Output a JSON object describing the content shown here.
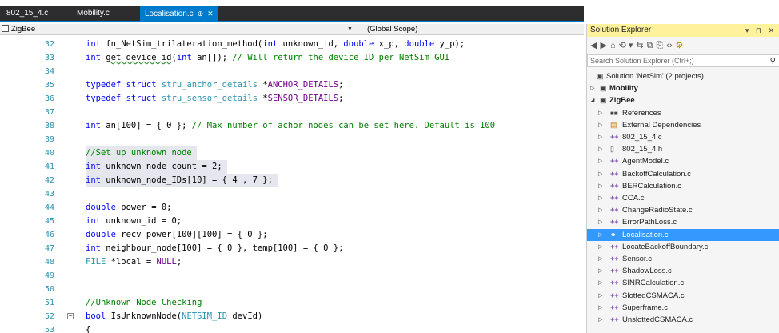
{
  "tabs": [
    {
      "label": "802_15_4.c",
      "active": false
    },
    {
      "label": "Mobility.c",
      "active": false
    },
    {
      "label": "Localisation.c",
      "active": true,
      "pin": "⊕",
      "close": "✕"
    }
  ],
  "navbar": {
    "project": "ZigBee",
    "scope": "(Global Scope)"
  },
  "code_lines": [
    {
      "n": "32",
      "html": "<span class=\"kw\">int</span> fn_NetSim_trilateration_method(<span class=\"kw\">int</span> unknown_id, <span class=\"kw\">double</span> x_p, <span class=\"kw\">double</span> y_p);"
    },
    {
      "n": "33",
      "html": "<span class=\"kw\">int</span> <span class=\"squig\">get_device_id</span>(<span class=\"kw\">int</span> an[]); <span class=\"cm\">// Will return the device ID per NetSim GUI</span>"
    },
    {
      "n": "34",
      "html": ""
    },
    {
      "n": "35",
      "html": "<span class=\"kw\">typedef</span> <span class=\"kw\">struct</span> <span class=\"ty\">stru_anchor_details</span> *<span class=\"pp\">ANCHOR_DETAILS</span>;"
    },
    {
      "n": "36",
      "html": "<span class=\"kw\">typedef</span> <span class=\"kw\">struct</span> <span class=\"ty\">stru_sensor_details</span> *<span class=\"pp\">SENSOR_DETAILS</span>;"
    },
    {
      "n": "37",
      "html": ""
    },
    {
      "n": "38",
      "html": "<span class=\"kw\">int</span> an[100] = { 0 }; <span class=\"cm\">// Max number of achor nodes can be set here. Default is 100</span>"
    },
    {
      "n": "39",
      "html": ""
    },
    {
      "n": "40",
      "html": "<span class=\"cm\">//Set up unknown node</span>",
      "hl": 163
    },
    {
      "n": "41",
      "html": "<span class=\"kw\">int</span> unknown_node_count = 2;",
      "hl": 202
    },
    {
      "n": "42",
      "html": "<span class=\"kw\">int</span> unknown_node_IDs[10] = { 4 , 7 };",
      "hl": 272
    },
    {
      "n": "43",
      "html": ""
    },
    {
      "n": "44",
      "html": "<span class=\"kw\">double</span> power = 0;"
    },
    {
      "n": "45",
      "html": "<span class=\"kw\">int</span> unknown_id = 0;"
    },
    {
      "n": "46",
      "html": "<span class=\"kw\">double</span> recv_power[100][100] = { 0 };"
    },
    {
      "n": "47",
      "html": "<span class=\"kw\">int</span> neighbour_node[100] = { 0 }, temp[100] = { 0 };"
    },
    {
      "n": "48",
      "html": "<span class=\"ty\">FILE</span> *local = <span class=\"pp\">NULL</span>;"
    },
    {
      "n": "49",
      "html": ""
    },
    {
      "n": "50",
      "html": ""
    },
    {
      "n": "51",
      "html": "<span class=\"cm\">//Unknown Node Checking</span>"
    },
    {
      "n": "52",
      "html": "<span class=\"kw\">bool</span> IsUnknownNode(<span class=\"ty\">NETSIM_ID</span> devId)",
      "fold": true
    },
    {
      "n": "53",
      "html": "{"
    }
  ],
  "explorer": {
    "title": "Solution Explorer",
    "title_controls": "▾ ⊓ ✕",
    "search_placeholder": "Search Solution Explorer (Ctrl+;)",
    "toolbar": [
      "◀",
      "▶",
      "⌂",
      "⟲ ▾",
      "⇆",
      "⧉",
      "⎘",
      "‹›",
      "⚙"
    ],
    "tree": [
      {
        "label": "Solution 'NetSim' (2 projects)",
        "depth": 0,
        "arrow": "",
        "icon": "▣",
        "icon_class": "sol"
      },
      {
        "label": "Mobility",
        "depth": 0,
        "arrow": "▷",
        "icon": "▣",
        "icon_class": "proj",
        "bold": true
      },
      {
        "label": "ZigBee",
        "depth": 0,
        "arrow": "◢",
        "icon": "▣",
        "icon_class": "proj",
        "bold": true
      },
      {
        "label": "References",
        "depth": 1,
        "arrow": "▷",
        "icon": "■■",
        "icon_class": "ref"
      },
      {
        "label": "External Dependencies",
        "depth": 1,
        "arrow": "▷",
        "icon": "▤",
        "icon_class": "ext"
      },
      {
        "label": "802_15_4.c",
        "depth": 1,
        "arrow": "▷",
        "icon": "++",
        "icon_class": "cfile"
      },
      {
        "label": "802_15_4.h",
        "depth": 1,
        "arrow": "▷",
        "icon": "▯",
        "icon_class": "proj"
      },
      {
        "label": "AgentModel.c",
        "depth": 1,
        "arrow": "▷",
        "icon": "++",
        "icon_class": "cfile"
      },
      {
        "label": "BackoffCalculation.c",
        "depth": 1,
        "arrow": "▷",
        "icon": "++",
        "icon_class": "cfile"
      },
      {
        "label": "BERCalculation.c",
        "depth": 1,
        "arrow": "▷",
        "icon": "++",
        "icon_class": "cfile"
      },
      {
        "label": "CCA.c",
        "depth": 1,
        "arrow": "▷",
        "icon": "++",
        "icon_class": "cfile"
      },
      {
        "label": "ChangeRadioState.c",
        "depth": 1,
        "arrow": "▷",
        "icon": "++",
        "icon_class": "cfile"
      },
      {
        "label": "ErrorPathLoss.c",
        "depth": 1,
        "arrow": "▷",
        "icon": "++",
        "icon_class": "cfile"
      },
      {
        "label": "Localisation.c",
        "depth": 1,
        "arrow": "▷",
        "icon": "⚭",
        "icon_class": "cfile",
        "selected": true
      },
      {
        "label": "LocateBackoffBoundary.c",
        "depth": 1,
        "arrow": "▷",
        "icon": "++",
        "icon_class": "cfile"
      },
      {
        "label": "Sensor.c",
        "depth": 1,
        "arrow": "▷",
        "icon": "++",
        "icon_class": "cfile"
      },
      {
        "label": "ShadowLoss.c",
        "depth": 1,
        "arrow": "▷",
        "icon": "++",
        "icon_class": "cfile"
      },
      {
        "label": "SINRCalculation.c",
        "depth": 1,
        "arrow": "▷",
        "icon": "++",
        "icon_class": "cfile"
      },
      {
        "label": "SlottedCSMACA.c",
        "depth": 1,
        "arrow": "▷",
        "icon": "++",
        "icon_class": "cfile"
      },
      {
        "label": "Superframe.c",
        "depth": 1,
        "arrow": "▷",
        "icon": "++",
        "icon_class": "cfile"
      },
      {
        "label": "UnslottedCSMACA.c",
        "depth": 1,
        "arrow": "▷",
        "icon": "++",
        "icon_class": "cfile"
      }
    ]
  }
}
